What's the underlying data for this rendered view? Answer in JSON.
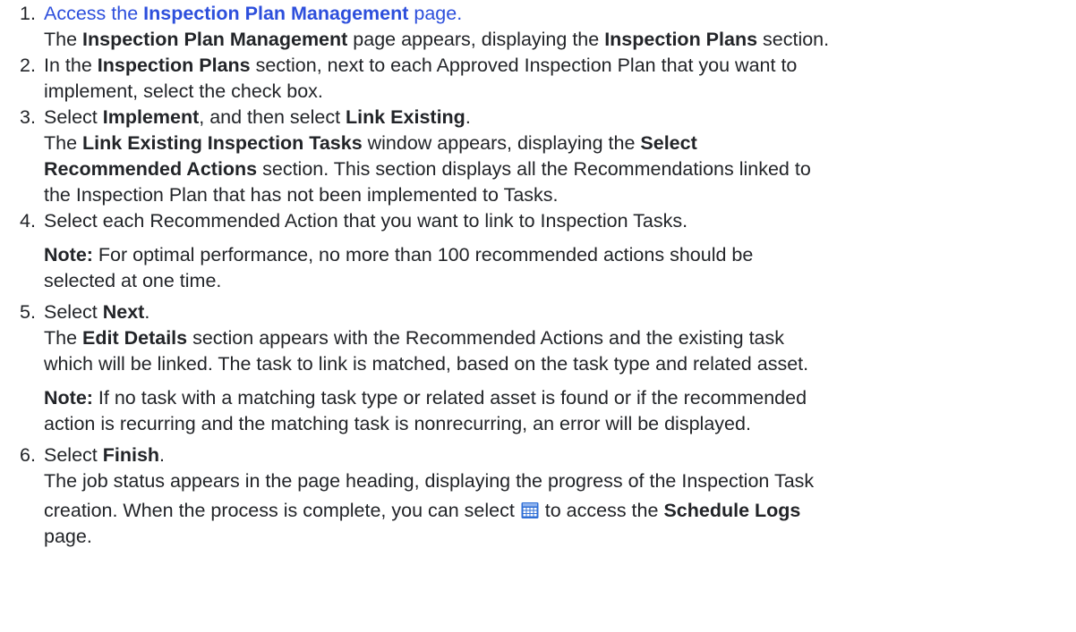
{
  "steps": [
    {
      "num": "1.",
      "link_pre": "Access the ",
      "link_bold": "Inspection Plan Management",
      "link_post": " page.",
      "result": [
        {
          "t": "The ",
          "b": false
        },
        {
          "t": "Inspection Plan Management",
          "b": true
        },
        {
          "t": " page appears, displaying the ",
          "b": false
        },
        {
          "t": "Inspection Plans",
          "b": true
        },
        {
          "t": " section.",
          "b": false
        }
      ]
    },
    {
      "num": "2.",
      "line1": [
        {
          "t": "In the ",
          "b": false
        },
        {
          "t": "Inspection Plans",
          "b": true
        },
        {
          "t": " section, next to each Approved Inspection Plan that you want to",
          "b": false
        }
      ],
      "line2": "implement, select the check box."
    },
    {
      "num": "3.",
      "line1": [
        {
          "t": "Select ",
          "b": false
        },
        {
          "t": "Implement",
          "b": true
        },
        {
          "t": ", and then select ",
          "b": false
        },
        {
          "t": "Link Existing",
          "b": true
        },
        {
          "t": ".",
          "b": false
        }
      ],
      "line2": [
        {
          "t": "The ",
          "b": false
        },
        {
          "t": "Link Existing Inspection Tasks",
          "b": true
        },
        {
          "t": " window appears, displaying the ",
          "b": false
        },
        {
          "t": "Select",
          "b": true
        }
      ],
      "line3": [
        {
          "t": "Recommended Actions",
          "b": true
        },
        {
          "t": " section. This section displays all the Recommendations linked to",
          "b": false
        }
      ],
      "line4": "the Inspection Plan that has not been implemented to Tasks."
    },
    {
      "num": "4.",
      "line1": "Select each Recommended Action that you want to link to Inspection Tasks.",
      "note_label": "Note:",
      "note_line1": " For optimal performance, no more than 100 recommended actions should be",
      "note_line2": "selected at one time."
    },
    {
      "num": "5.",
      "line1_pre": "Select ",
      "line1_bold": "Next",
      "line1_post": ".",
      "line2_pre": "The ",
      "line2_bold": "Edit Details",
      "line2_post": " section appears with the Recommended Actions and the existing task",
      "line3": "which will be linked. The task to link is matched, based on the task type and related asset.",
      "note_label": "Note:",
      "note_line1": " If no task with a matching task type or related asset is found or if the recommended",
      "note_line2": "action is recurring and the matching task is nonrecurring, an error will be displayed."
    },
    {
      "num": "6.",
      "line1_pre": "Select ",
      "line1_bold": "Finish",
      "line1_post": ".",
      "line2": "The job status appears in the page heading, displaying the progress of the Inspection Task",
      "line3_pre": "creation. When the process is complete, you can select ",
      "line3_icon": "calendar-grid-icon",
      "line3_mid": " to access the ",
      "line3_bold": "Schedule Logs",
      "line4": "page."
    }
  ],
  "colors": {
    "text": "#222428",
    "link": "#2d4fdc",
    "icon_blue": "#2f6fd6"
  }
}
